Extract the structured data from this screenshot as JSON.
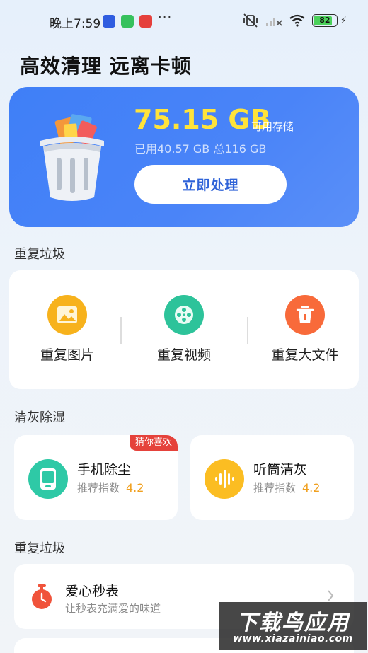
{
  "status_bar": {
    "time": "晚上7:59",
    "more": "···",
    "battery": "82",
    "battery_level": 0.82
  },
  "header": {
    "title": "高效清理 远离卡顿"
  },
  "storage": {
    "available": "75.15 GB",
    "available_label": "可用存储",
    "usage": "已用40.57 GB 总116 GB",
    "action_label": "立即处理"
  },
  "duplicates": {
    "section_title": "重复垃圾",
    "items": [
      {
        "label": "重复图片",
        "icon": "image-icon",
        "color": "#f7b21c"
      },
      {
        "label": "重复视频",
        "icon": "film-reel-icon",
        "color": "#2dc39a"
      },
      {
        "label": "重复大文件",
        "icon": "trash-icon",
        "color": "#f86a3a"
      }
    ]
  },
  "dust": {
    "section_title": "清灰除湿",
    "rating_label": "推荐指数",
    "items": [
      {
        "name": "手机除尘",
        "rating": "4.2",
        "badge": "猜你喜欢",
        "icon": "phone-icon",
        "color": "#2ec9a6"
      },
      {
        "name": "听筒清灰",
        "rating": "4.2",
        "icon": "sound-wave-icon",
        "color": "#fbbd22"
      }
    ]
  },
  "tools": {
    "section_title": "重复垃圾",
    "items": [
      {
        "title": "爱心秒表",
        "subtitle": "让秒表充满爱的味道",
        "icon": "stopwatch-icon",
        "color": "#f0533b"
      }
    ]
  },
  "watermark": {
    "title": "下载鸟应用",
    "url": "www.xiazainiao.com"
  }
}
